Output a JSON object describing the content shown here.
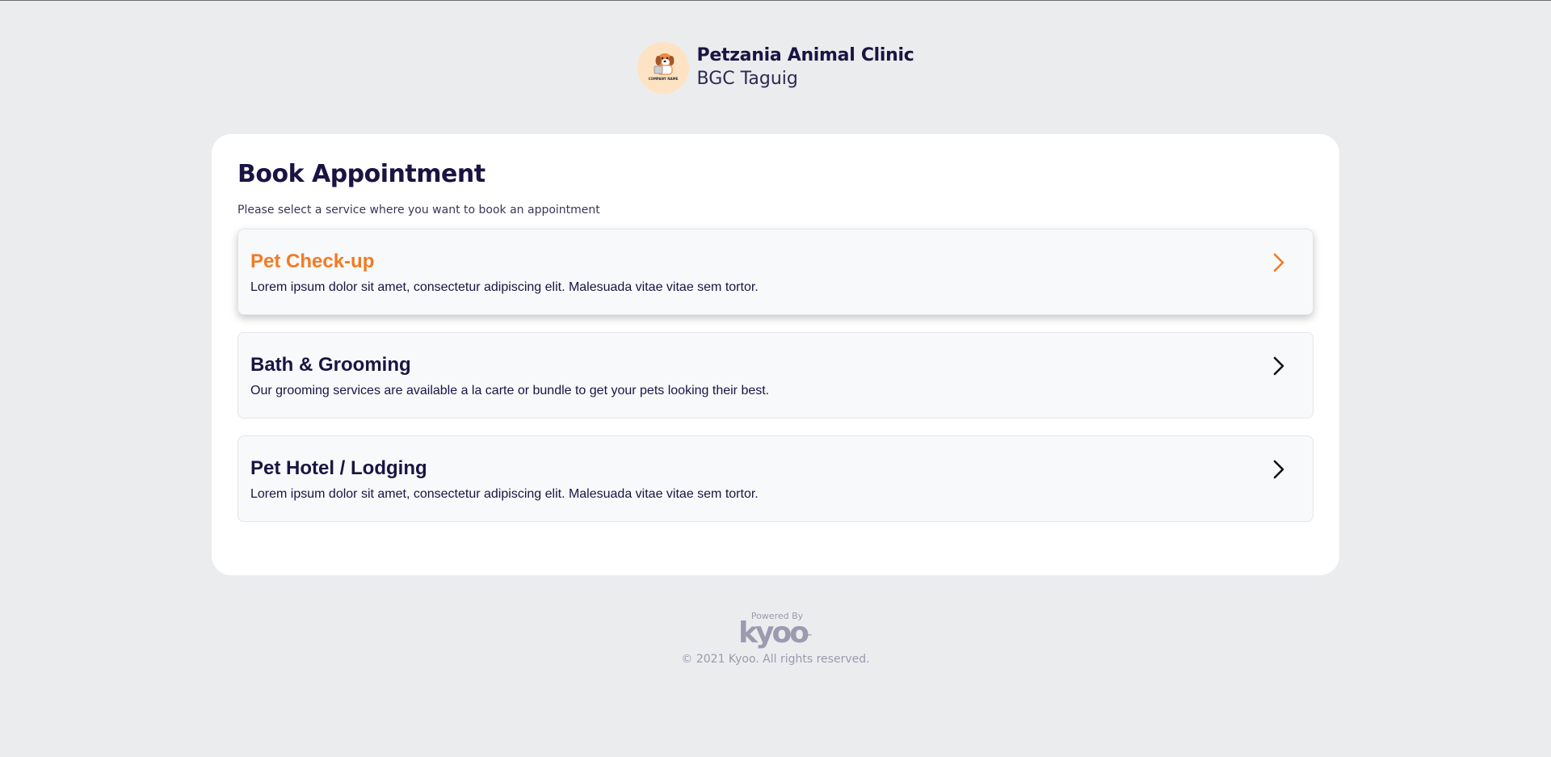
{
  "clinic": {
    "name": "Petzania Animal Clinic",
    "location": "BGC Taguig",
    "logo_icon": "dog-logo-icon",
    "logo_text": "COMPANY NAME"
  },
  "booking": {
    "title": "Book Appointment",
    "subtitle": "Please select a service where you want to book an appointment"
  },
  "services": [
    {
      "title": "Pet Check-up",
      "description": "Lorem ipsum dolor sit amet, consectetur adipiscing elit. Malesuada vitae vitae sem tortor.",
      "selected": true
    },
    {
      "title": "Bath & Grooming",
      "description": "Our grooming services are available a la carte or bundle to get your pets looking their best.",
      "selected": false
    },
    {
      "title": "Pet Hotel / Lodging",
      "description": "Lorem ipsum dolor sit amet, consectetur adipiscing elit. Malesuada vitae vitae sem tortor.",
      "selected": false
    }
  ],
  "footer": {
    "powered_by": "Powered By",
    "brand": "kyoo",
    "trademark": "™",
    "copyright": "© 2021 Kyoo. All rights reserved."
  },
  "colors": {
    "accent": "#f47a20",
    "text_primary": "#1a1442",
    "background": "#ebecee",
    "card": "#ffffff"
  },
  "icons": {
    "chevron": "chevron-right-icon"
  }
}
